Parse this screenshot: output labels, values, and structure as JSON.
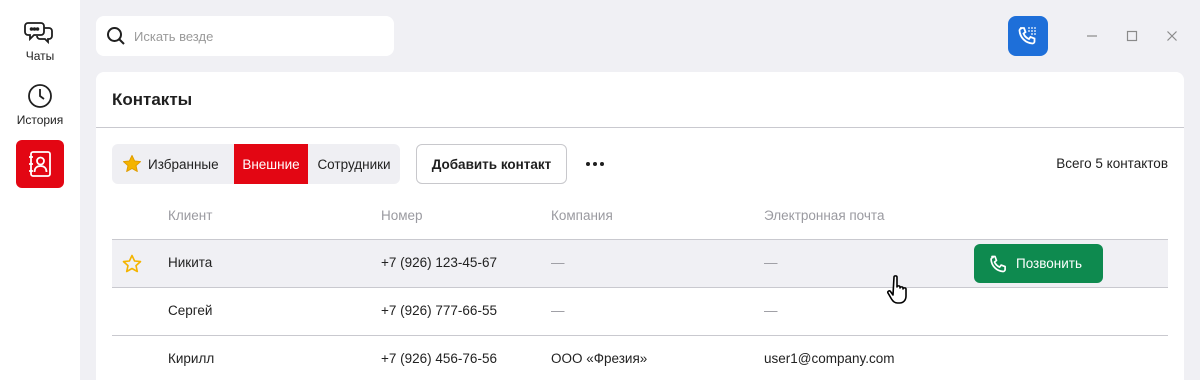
{
  "nav": {
    "chats_label": "Чаты",
    "history_label": "История",
    "contacts_icon": "contact-book-icon"
  },
  "search": {
    "placeholder": "Искать везде",
    "value": ""
  },
  "colors": {
    "accent": "#e30613",
    "call_green": "#0e8a4f",
    "app_blue": "#1e6fd9",
    "star": "#f4b400"
  },
  "panel": {
    "title": "Контакты",
    "tabs": [
      {
        "label": "Избранные",
        "active": false
      },
      {
        "label": "Внешние",
        "active": true
      },
      {
        "label": "Сотрудники",
        "active": false
      }
    ],
    "add_button": "Добавить контакт",
    "total": "Всего 5 контактов"
  },
  "table": {
    "headers": [
      "Клиент",
      "Номер",
      "Компания",
      "Электронная почта"
    ],
    "rows": [
      {
        "favorite": true,
        "name": "Никита",
        "phone": "+7 (926) 123-45-67",
        "company": "—",
        "email": "—",
        "action": "Позвонить"
      },
      {
        "favorite": false,
        "name": "Сергей",
        "phone": "+7 (926) 777-66-55",
        "company": "—",
        "email": "—"
      },
      {
        "favorite": false,
        "name": "Кирилл",
        "phone": "+7 (926) 456-76-56",
        "company": "ООО «Фрезия»",
        "email": "user1@company.com"
      }
    ]
  }
}
